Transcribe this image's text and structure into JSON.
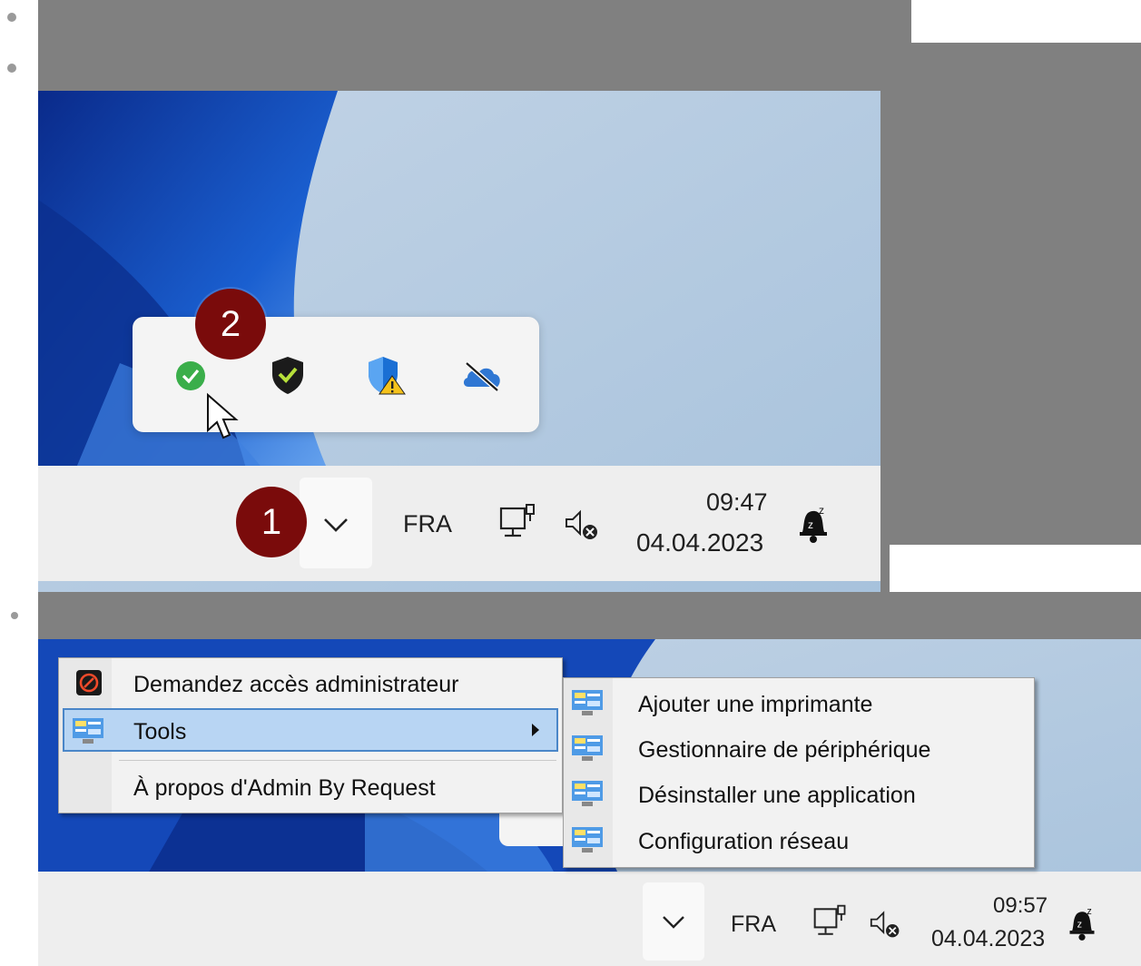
{
  "step1": {
    "badge1": "1",
    "badge2": "2",
    "tray": {
      "language": "FRA",
      "time": "09:47",
      "date": "04.04.2023"
    },
    "flyout_icons": [
      "green-check-icon",
      "shield-check-icon",
      "defender-warning-icon",
      "onedrive-off-icon"
    ]
  },
  "step2": {
    "menu": {
      "items": [
        {
          "label": "Demandez accès administrateur",
          "icon": "admin-by-request-icon"
        },
        {
          "label": "Tools",
          "icon": "tools-icon"
        },
        {
          "label": "À propos d'Admin By Request",
          "icon": ""
        }
      ]
    },
    "submenu": {
      "items": [
        {
          "label": "Ajouter une imprimante",
          "icon": "tools-icon"
        },
        {
          "label": "Gestionnaire de périphérique",
          "icon": "tools-icon"
        },
        {
          "label": "Désinstaller une application",
          "icon": "tools-icon"
        },
        {
          "label": "Configuration réseau",
          "icon": "tools-icon"
        }
      ]
    },
    "tray": {
      "language": "FRA",
      "time": "09:57",
      "date": "04.04.2023"
    }
  },
  "colors": {
    "badge": "#7a0b0b",
    "highlight": "#b8d5f3",
    "highlight_border": "#4a86c8"
  }
}
